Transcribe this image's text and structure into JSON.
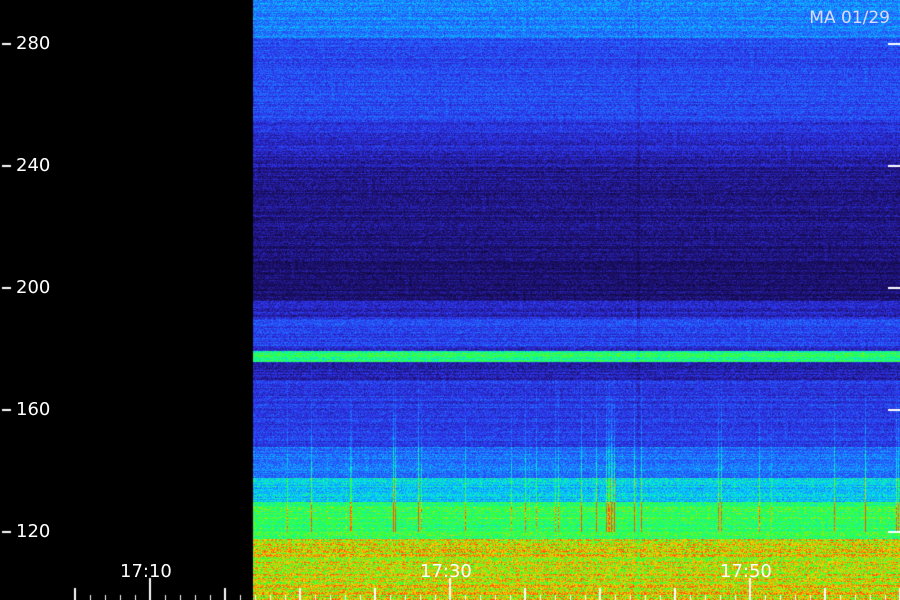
{
  "station_label": "MA 01/29",
  "chart_data": {
    "type": "heatmap",
    "title": "",
    "xlabel": "",
    "ylabel": "",
    "x_tick_labels": [
      "17:10",
      "17:30",
      "17:50"
    ],
    "y_ticks": [
      280,
      240,
      200,
      160,
      120
    ],
    "ylim": [
      108,
      290
    ],
    "x_range": [
      "17:00",
      "18:00"
    ],
    "data_start_time": "17:17",
    "bands": [
      {
        "y_min": 108,
        "y_max": 118,
        "level": "high",
        "color": "#ffbf00"
      },
      {
        "y_min": 118,
        "y_max": 130,
        "level": "medium",
        "color": "#22ff44"
      },
      {
        "y_min": 130,
        "y_max": 145,
        "level": "low-medium",
        "color": "#1fa0ff"
      },
      {
        "y_min": 176,
        "y_max": 179,
        "level": "medium",
        "color": "#22ff88"
      },
      {
        "y_min": 190,
        "y_max": 240,
        "level": "very-low",
        "color": "#140a5a"
      },
      {
        "y_min": 240,
        "y_max": 290,
        "level": "low",
        "color": "#2a3cff"
      }
    ],
    "colors": {
      "background": "#000000",
      "axis": "#ffffff",
      "noise_low": "#0a0840",
      "noise_mid": "#2a30e0",
      "noise_high": "#00c8ff",
      "band_green": "#22ff55",
      "band_yellow": "#ffd000"
    },
    "grid": false,
    "legend": "none"
  }
}
